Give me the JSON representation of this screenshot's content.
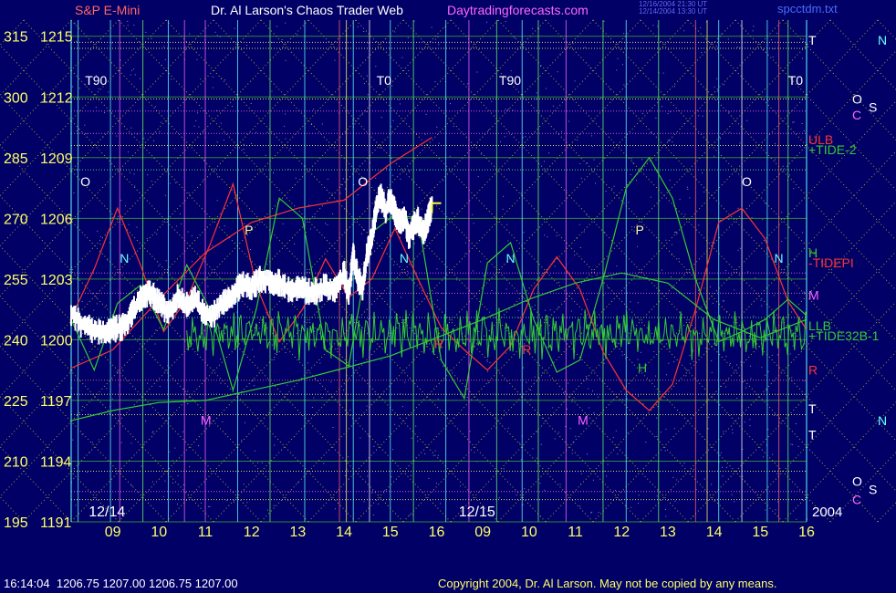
{
  "chart_data": {
    "type": "line",
    "title": "Dr. Al Larson's Chaos Trader Web",
    "site": "Daytradingforecasts.com",
    "symbol_label": "S&P E-Mini",
    "stamp_lines": [
      "12/16/2004 21:30 UT",
      "12/14/2004 13:30 UT"
    ],
    "file_label": "spcctdm.txt",
    "year_label": "2004",
    "date_labels": [
      {
        "text": "12/14",
        "x": 8.4
      },
      {
        "text": "12/15",
        "x": 16.4
      }
    ],
    "y_ticks": [
      {
        "left": "315",
        "right": "1215",
        "value": 1215
      },
      {
        "left": "300",
        "right": "1212",
        "value": 1212
      },
      {
        "left": "285",
        "right": "1209",
        "value": 1209
      },
      {
        "left": "270",
        "right": "1206",
        "value": 1206
      },
      {
        "left": "255",
        "right": "1203",
        "value": 1203
      },
      {
        "left": "240",
        "right": "1200",
        "value": 1200
      },
      {
        "left": "225",
        "right": "1197",
        "value": 1197
      },
      {
        "left": "210",
        "right": "1194",
        "value": 1194
      },
      {
        "left": "195",
        "right": "1191",
        "value": 1191
      }
    ],
    "x_ticks": [
      {
        "label": "09",
        "x": 9
      },
      {
        "label": "10",
        "x": 10
      },
      {
        "label": "11",
        "x": 11
      },
      {
        "label": "12",
        "x": 12
      },
      {
        "label": "13",
        "x": 13
      },
      {
        "label": "14",
        "x": 14
      },
      {
        "label": "15",
        "x": 15
      },
      {
        "label": "16",
        "x": 16
      },
      {
        "label": "09",
        "x": 17
      },
      {
        "label": "10",
        "x": 18
      },
      {
        "label": "11",
        "x": 19
      },
      {
        "label": "12",
        "x": 20
      },
      {
        "label": "13",
        "x": 21
      },
      {
        "label": "14",
        "x": 22
      },
      {
        "label": "15",
        "x": 23
      },
      {
        "label": "16",
        "x": 24
      }
    ],
    "xlim": [
      8.1,
      24.0
    ],
    "ylim": [
      1191,
      1215.8
    ],
    "horizontal_levels": [
      {
        "y": 1214.7,
        "color": "#ffff66"
      },
      {
        "y": 1214.4,
        "color": "#ffff66"
      },
      {
        "y": 1211.9,
        "color": "#ffff66"
      },
      {
        "y": 1211.3,
        "color": "#ff66ff"
      },
      {
        "y": 1210.2,
        "color": "#ff66ff"
      },
      {
        "y": 1209.6,
        "color": "#ffff66"
      },
      {
        "y": 1208.4,
        "color": "#66ff66"
      },
      {
        "y": 1203.3,
        "color": "#ff66ff"
      },
      {
        "y": 1202.3,
        "color": "#ff66ff"
      },
      {
        "y": 1201.1,
        "color": "#66ff66"
      },
      {
        "y": 1198.0,
        "color": "#ff6666"
      },
      {
        "y": 1197.3,
        "color": "#ffff66"
      },
      {
        "y": 1196.3,
        "color": "#ffff66"
      },
      {
        "y": 1193.5,
        "color": "#ffff66"
      },
      {
        "y": 1192.5,
        "color": "#ff66ff"
      },
      {
        "y": 1192.1,
        "color": "#ffff66"
      }
    ],
    "vertical_lines": [
      {
        "x": 8.25,
        "color": "#66ffff"
      },
      {
        "x": 8.95,
        "color": "#66ffff"
      },
      {
        "x": 9.15,
        "color": "#ff66ff"
      },
      {
        "x": 9.65,
        "color": "#66ff66"
      },
      {
        "x": 10.2,
        "color": "#66ffff"
      },
      {
        "x": 10.55,
        "color": "#ff66ff"
      },
      {
        "x": 11.0,
        "color": "#ff66ff"
      },
      {
        "x": 11.7,
        "color": "#66ffff"
      },
      {
        "x": 12.4,
        "color": "#66ff66"
      },
      {
        "x": 13.15,
        "color": "#66ffff"
      },
      {
        "x": 13.9,
        "color": "#ff6666"
      },
      {
        "x": 14.05,
        "color": "#ffff66"
      },
      {
        "x": 14.2,
        "color": "#66ffff"
      },
      {
        "x": 14.55,
        "color": "#ffffff"
      },
      {
        "x": 15.0,
        "color": "#66ffff"
      },
      {
        "x": 15.5,
        "color": "#66ff66"
      },
      {
        "x": 16.2,
        "color": "#66ffff"
      },
      {
        "x": 16.7,
        "color": "#ff66ff"
      },
      {
        "x": 17.3,
        "color": "#66ff66"
      },
      {
        "x": 17.85,
        "color": "#66ffff"
      },
      {
        "x": 18.2,
        "color": "#66ff66"
      },
      {
        "x": 18.8,
        "color": "#ff66ff"
      },
      {
        "x": 19.6,
        "color": "#66ff66"
      },
      {
        "x": 20.1,
        "color": "#66ffff"
      },
      {
        "x": 20.8,
        "color": "#66ff66"
      },
      {
        "x": 21.6,
        "color": "#ff6666"
      },
      {
        "x": 21.85,
        "color": "#ffff66"
      },
      {
        "x": 22.1,
        "color": "#66ffff"
      },
      {
        "x": 22.6,
        "color": "#ffffff"
      },
      {
        "x": 23.15,
        "color": "#66ffff"
      },
      {
        "x": 23.4,
        "color": "#ff6666"
      },
      {
        "x": 23.6,
        "color": "#66ff66"
      }
    ],
    "price_bars": {
      "color": "#ffffff",
      "close_x": [
        8.1,
        8.4,
        8.7,
        9.0,
        9.2,
        9.4,
        9.6,
        9.8,
        10.0,
        10.2,
        10.4,
        10.6,
        10.8,
        11.0,
        11.2,
        11.4,
        11.6,
        11.8,
        12.0,
        12.2,
        12.4,
        12.6,
        12.8,
        13.0,
        13.2,
        13.4,
        13.6,
        13.8,
        14.0,
        14.1,
        14.2,
        14.3,
        14.4,
        14.5,
        14.6,
        14.7,
        14.8,
        14.9,
        15.0,
        15.1,
        15.2,
        15.3,
        15.4,
        15.5,
        15.6,
        15.7,
        15.8,
        15.9
      ],
      "close_y": [
        1201.3,
        1200.6,
        1200.4,
        1200.5,
        1200.6,
        1201.2,
        1202.1,
        1202.3,
        1201.9,
        1201.3,
        1202.1,
        1201.7,
        1202.0,
        1201.1,
        1201.3,
        1201.9,
        1202.2,
        1202.8,
        1202.6,
        1203.0,
        1202.9,
        1202.8,
        1202.5,
        1202.6,
        1202.4,
        1202.4,
        1202.6,
        1202.4,
        1203.3,
        1202.3,
        1204.1,
        1203.0,
        1202.6,
        1204.3,
        1205.0,
        1206.6,
        1207.1,
        1206.4,
        1207.0,
        1206.3,
        1205.8,
        1206.1,
        1205.1,
        1205.6,
        1205.9,
        1205.3,
        1205.8,
        1206.7
      ],
      "last_x": [
        15.9,
        16.1
      ],
      "last_y": 1206.75
    },
    "tide_red": {
      "color": "#ff3333",
      "x": [
        8.1,
        8.6,
        9.1,
        9.6,
        10.1,
        10.6,
        11.1,
        11.6,
        12.1,
        12.6,
        13.1,
        13.6,
        14.1,
        14.6,
        15.1,
        15.6,
        16.1,
        16.6,
        17.1,
        17.6,
        18.1,
        18.6,
        19.1,
        19.6,
        20.1,
        20.6,
        21.1,
        21.6,
        22.1,
        22.6,
        23.1,
        23.6,
        24.0
      ],
      "y": [
        1201.1,
        1203.5,
        1206.5,
        1203.7,
        1200.4,
        1202.0,
        1204.7,
        1207.7,
        1202.7,
        1199.9,
        1201.5,
        1204.0,
        1202.1,
        1203.0,
        1205.5,
        1203.0,
        1200.6,
        1199.5,
        1198.5,
        1199.7,
        1202.5,
        1204.1,
        1202.5,
        1199.4,
        1197.5,
        1196.5,
        1197.8,
        1201.5,
        1205.8,
        1206.5,
        1205.0,
        1201.9,
        1200.5
      ]
    },
    "ulb_red": {
      "color": "#ff3333",
      "x": [
        8.1,
        9.0,
        10.0,
        11.0,
        12.0,
        13.0,
        14.0,
        15.0,
        15.9
      ],
      "y": [
        1198.6,
        1199.5,
        1202.0,
        1204.3,
        1205.8,
        1206.5,
        1206.9,
        1208.7,
        1210.0
      ]
    },
    "tide_green": {
      "color": "#33cc33",
      "x": [
        8.1,
        8.6,
        9.1,
        9.6,
        10.1,
        10.6,
        11.1,
        11.6,
        12.1,
        12.6,
        13.1,
        13.6,
        14.1,
        14.6,
        15.1,
        15.6,
        16.1,
        16.6,
        17.1,
        17.6,
        18.1,
        18.6,
        19.1,
        19.6,
        20.1,
        20.6,
        21.1,
        21.6,
        22.1,
        22.6,
        23.1,
        23.6,
        24.0
      ],
      "y": [
        1201.0,
        1198.5,
        1201.8,
        1202.7,
        1200.5,
        1203.7,
        1201.5,
        1197.5,
        1201.5,
        1207.0,
        1206.0,
        1199.5,
        1198.7,
        1205.3,
        1206.2,
        1206.0,
        1199.0,
        1197.1,
        1203.8,
        1204.8,
        1201.0,
        1198.4,
        1199.0,
        1203.0,
        1207.5,
        1209.0,
        1207.0,
        1203.0,
        1199.9,
        1200.4,
        1201.0,
        1202.0,
        1201.2
      ]
    },
    "llb_green": {
      "color": "#33cc33",
      "x": [
        8.1,
        9.0,
        10.0,
        11.0,
        12.0,
        13.0,
        14.0,
        15.0,
        16.0,
        17.0,
        18.0,
        19.0,
        20.0,
        21.0,
        22.0,
        23.0,
        24.0
      ],
      "y": [
        1196.0,
        1196.5,
        1196.9,
        1197.0,
        1197.5,
        1198.0,
        1198.6,
        1199.2,
        1200.1,
        1201.0,
        1202.0,
        1202.8,
        1203.3,
        1202.8,
        1201.0,
        1200.1,
        1201.0
      ]
    },
    "tide32_noise": {
      "color": "#33cc33",
      "x_start": 10.6,
      "x_end": 24.0,
      "y_center": 1200.3
    },
    "annotations": [
      {
        "text": "O",
        "x": 8.3,
        "y": 1207.6,
        "color": "#ffffff"
      },
      {
        "text": "P",
        "x": 11.85,
        "y": 1205.2,
        "color": "#ffff99"
      },
      {
        "text": "N",
        "x": 9.15,
        "y": 1203.8,
        "color": "#66ffff"
      },
      {
        "text": "O",
        "x": 14.3,
        "y": 1207.6,
        "color": "#ffffff"
      },
      {
        "text": "N",
        "x": 15.2,
        "y": 1203.8,
        "color": "#66ffff"
      },
      {
        "text": "N",
        "x": 17.5,
        "y": 1203.8,
        "color": "#66ffff"
      },
      {
        "text": "P",
        "x": 20.3,
        "y": 1205.2,
        "color": "#ffff99"
      },
      {
        "text": "O",
        "x": 22.6,
        "y": 1207.6,
        "color": "#ffffff"
      },
      {
        "text": "N",
        "x": 23.3,
        "y": 1203.8,
        "color": "#66ffff"
      },
      {
        "text": "M",
        "x": 10.9,
        "y": 1195.8,
        "color": "#ff66ff"
      },
      {
        "text": "M",
        "x": 19.05,
        "y": 1195.8,
        "color": "#ff66ff"
      },
      {
        "text": "H",
        "x": 20.35,
        "y": 1198.4,
        "color": "#33cc33"
      },
      {
        "text": "R",
        "x": 15.95,
        "y": 1199.6,
        "color": "#ff3333"
      },
      {
        "text": "R",
        "x": 17.85,
        "y": 1199.3,
        "color": "#ff3333"
      },
      {
        "text": "T90",
        "x": 8.4,
        "y": 1212.6,
        "color": "#ffffff"
      },
      {
        "text": "T0",
        "x": 14.7,
        "y": 1212.6,
        "color": "#ffffff"
      },
      {
        "text": "T90",
        "x": 17.35,
        "y": 1212.6,
        "color": "#ffffff"
      },
      {
        "text": "T0",
        "x": 23.6,
        "y": 1212.6,
        "color": "#ffffff"
      }
    ],
    "right_labels": [
      {
        "text": "T",
        "y": 1214.8,
        "color": "#ffffff"
      },
      {
        "text": "ULB",
        "y": 1209.9,
        "color": "#ff3333"
      },
      {
        "text": "+TIDE-2",
        "y": 1209.4,
        "color": "#33cc33"
      },
      {
        "text": "H",
        "y": 1204.3,
        "color": "#33cc33"
      },
      {
        "text": "-TIDEPI",
        "y": 1203.8,
        "color": "#ff3333"
      },
      {
        "text": "M",
        "y": 1202.2,
        "color": "#ff66ff"
      },
      {
        "text": "LLB",
        "y": 1200.7,
        "color": "#33cc33"
      },
      {
        "text": "+TIDE32B-1",
        "y": 1200.2,
        "color": "#33cc33"
      },
      {
        "text": "R",
        "y": 1198.5,
        "color": "#ff3333"
      },
      {
        "text": "T",
        "y": 1196.6,
        "color": "#ffffff"
      },
      {
        "text": "T",
        "y": 1195.3,
        "color": "#ffffff"
      }
    ],
    "legend_right": [
      {
        "text": "N",
        "y": 1214.8,
        "color": "#66ffff"
      },
      {
        "text": "O",
        "y": 1211.9,
        "color": "#ffffff"
      },
      {
        "text": "C",
        "y": 1211.1,
        "color": "#ff66ff"
      },
      {
        "text": "S",
        "y": 1211.5,
        "color": "#ffffff"
      },
      {
        "text": "N",
        "y": 1196.0,
        "color": "#66ffff"
      },
      {
        "text": "O",
        "y": 1193.0,
        "color": "#ffffff"
      },
      {
        "text": "C",
        "y": 1192.1,
        "color": "#ff66ff"
      },
      {
        "text": "S",
        "y": 1192.6,
        "color": "#ffffff"
      }
    ]
  },
  "footer": {
    "time": "16:14:04",
    "quote": "1206.75 1207.00 1206.75 1207.00",
    "copyright": "Copyright 2004, Dr. Al Larson. May not be copied by any means."
  }
}
